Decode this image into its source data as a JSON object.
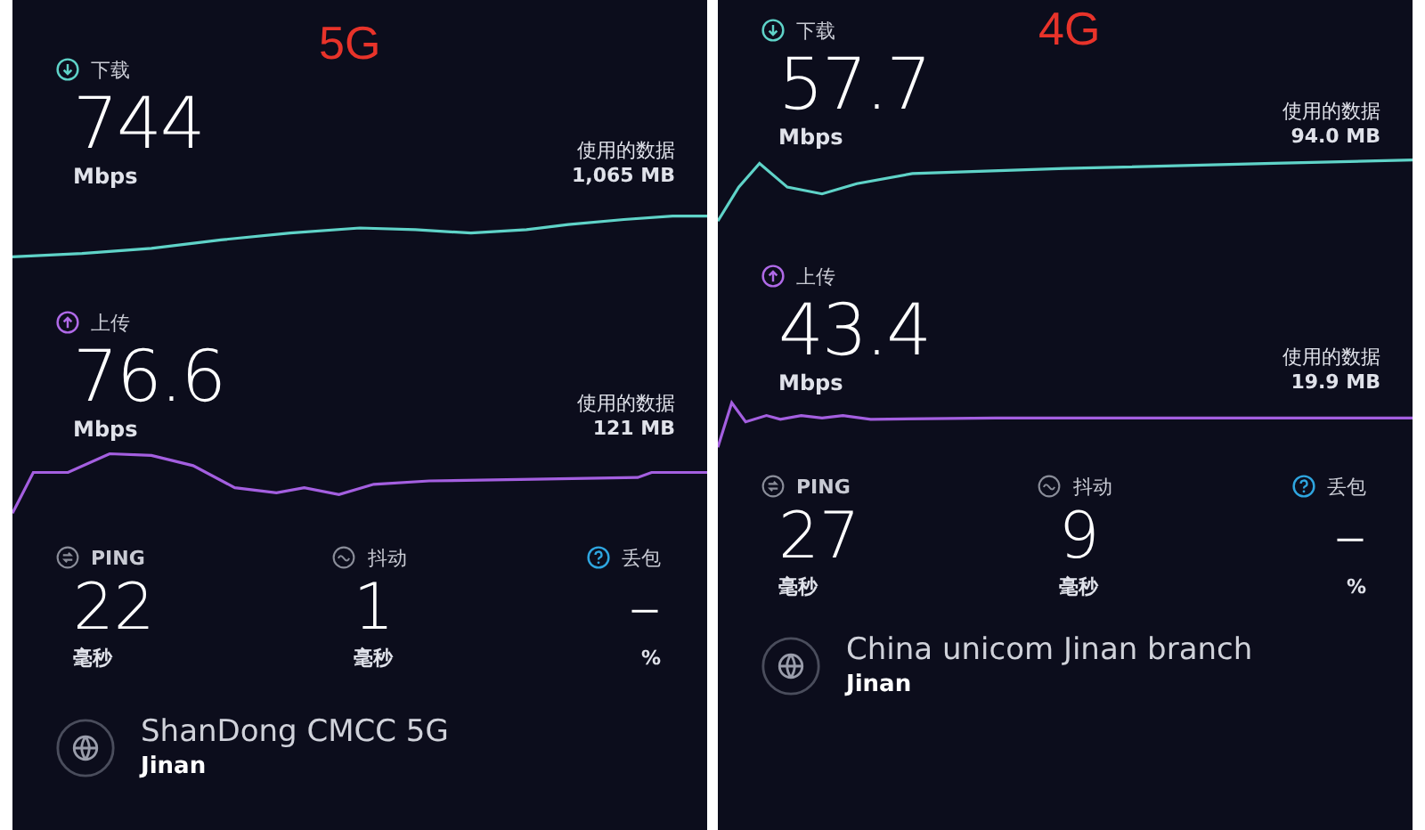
{
  "panels": [
    {
      "network_label": "5G",
      "download": {
        "label": "下载",
        "value": "744",
        "unit": "Mbps",
        "data_used_label": "使用的数据",
        "data_used": "1,065 MB"
      },
      "upload": {
        "label": "上传",
        "value": "76.6",
        "unit": "Mbps",
        "data_used_label": "使用的数据",
        "data_used": "121 MB"
      },
      "metrics": [
        {
          "kind": "ping",
          "label": "PING",
          "value": "22",
          "unit": "毫秒"
        },
        {
          "kind": "jitter",
          "label": "抖动",
          "value": "1",
          "unit": "毫秒"
        },
        {
          "kind": "loss",
          "label": "丢包",
          "value": "–",
          "unit": "%"
        }
      ],
      "server": {
        "name": "ShanDong CMCC 5G",
        "location": "Jinan"
      }
    },
    {
      "network_label": "4G",
      "download": {
        "label": "下载",
        "value": "57.7",
        "unit": "Mbps",
        "data_used_label": "使用的数据",
        "data_used": "94.0 MB"
      },
      "upload": {
        "label": "上传",
        "value": "43.4",
        "unit": "Mbps",
        "data_used_label": "使用的数据",
        "data_used": "19.9 MB"
      },
      "metrics": [
        {
          "kind": "ping",
          "label": "PING",
          "value": "27",
          "unit": "毫秒"
        },
        {
          "kind": "jitter",
          "label": "抖动",
          "value": "9",
          "unit": "毫秒"
        },
        {
          "kind": "loss",
          "label": "丢包",
          "value": "–",
          "unit": "%"
        }
      ],
      "server": {
        "name": "China unicom Jinan branch",
        "location": "Jinan"
      }
    }
  ]
}
